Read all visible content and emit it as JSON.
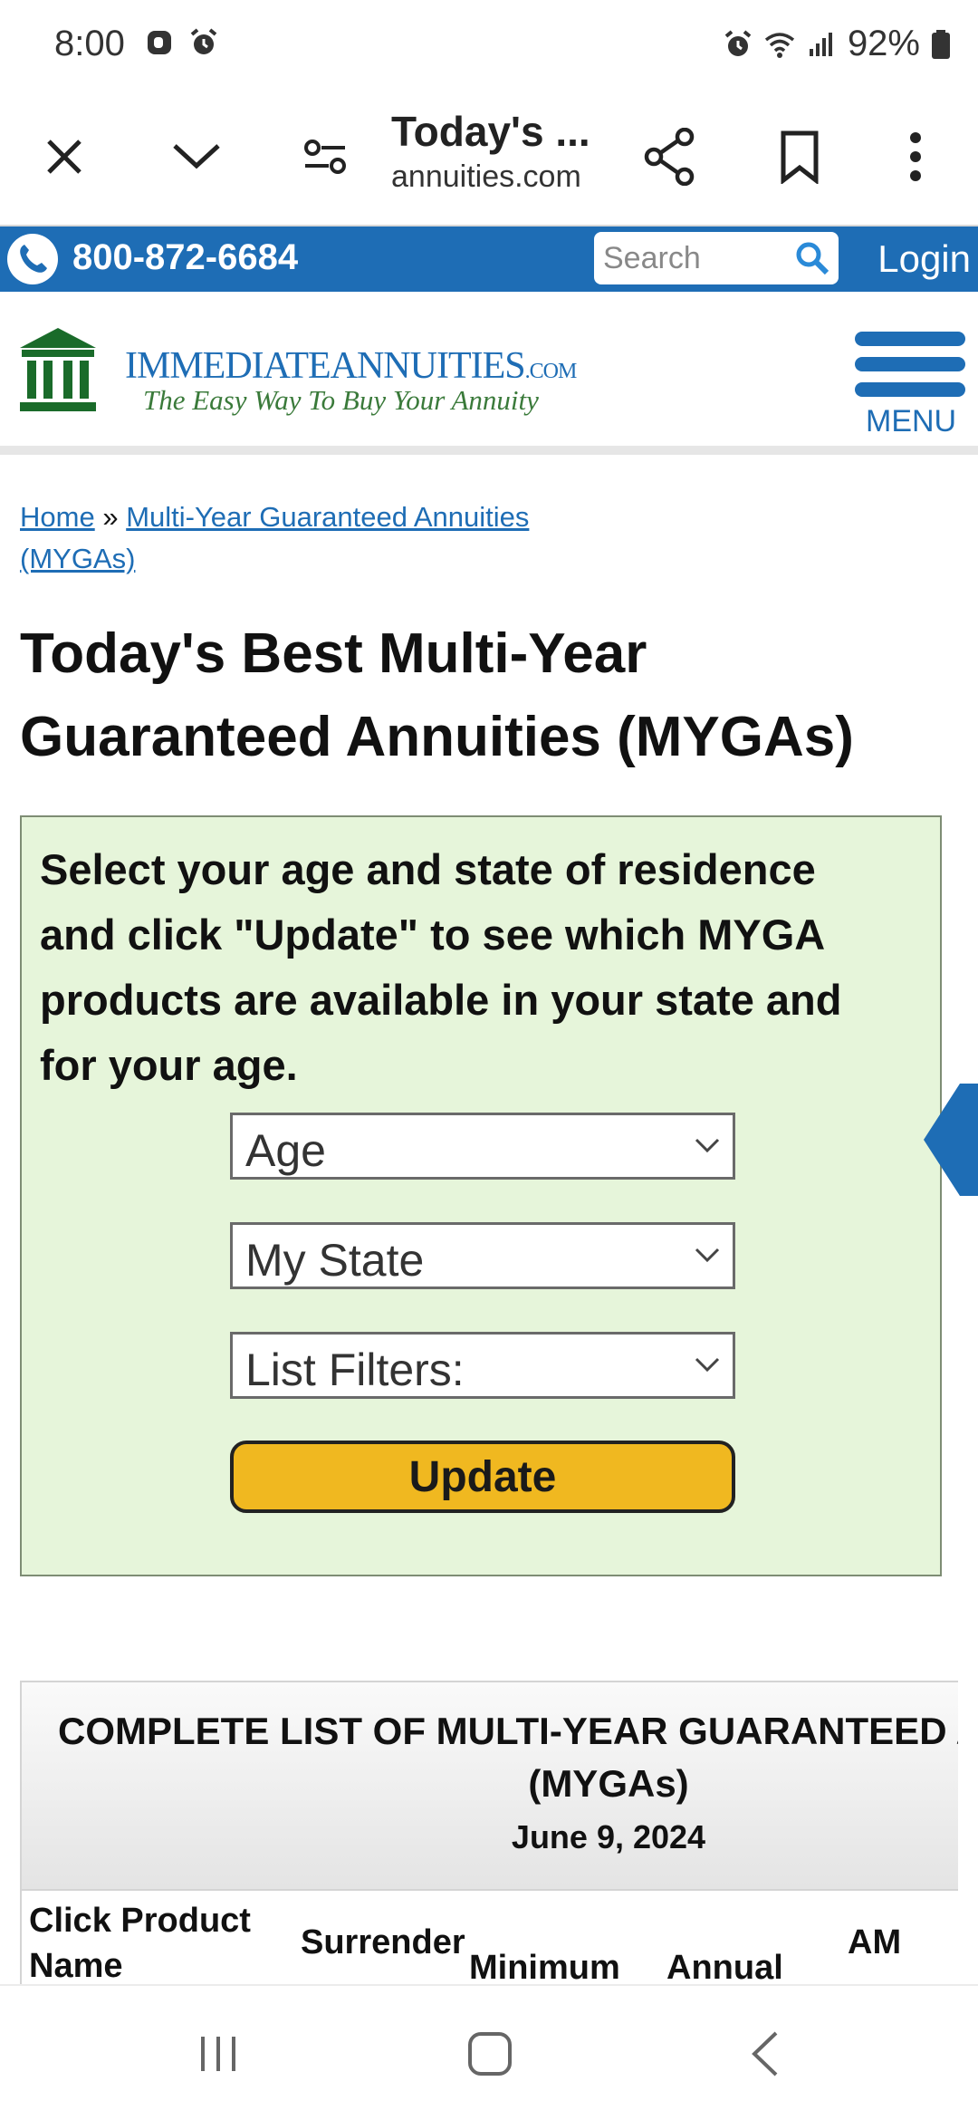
{
  "status_bar": {
    "time": "8:00",
    "battery": "92%"
  },
  "toolbar": {
    "page_title": "Today's ...",
    "page_domain": "annuities.com"
  },
  "top_bar": {
    "phone": "800-872-6684",
    "search_placeholder": "Search",
    "login_label": "Login",
    "accent_color": "#1e6db5"
  },
  "header": {
    "logo_main": "IMMEDIATEANNUITIES",
    "logo_com": ".COM",
    "logo_tagline": "The Easy Way To Buy Your Annuity",
    "menu_label": "MENU"
  },
  "breadcrumb": {
    "home": "Home",
    "separator": "»",
    "current_line1": "Multi-Year Guaranteed Annuities",
    "current_line2": "(MYGAs)"
  },
  "page_title": {
    "line1": "Today's Best Multi-Year",
    "line2": "Guaranteed Annuities (MYGAs)"
  },
  "form": {
    "intro_lines": [
      "Select your age and state of residence",
      "and click \"Update\" to see which MYGA",
      "products are available in your state and",
      "for your age."
    ],
    "age_select": "Age",
    "state_select": "My State",
    "filters_select": "List Filters:",
    "update_label": "Update",
    "panel_color": "#e6f5da",
    "button_color": "#f0b820"
  },
  "table": {
    "title_line1": "COMPLETE LIST OF MULTI-YEAR GUARANTEED A",
    "title_line2": "(MYGAs)",
    "date": "June 9, 2024",
    "columns": {
      "product_line1": "Click Product",
      "product_line2": "Name",
      "surrender": "Surrender",
      "minimum": "Minimum",
      "annual": "Annual",
      "am": "AM"
    }
  }
}
